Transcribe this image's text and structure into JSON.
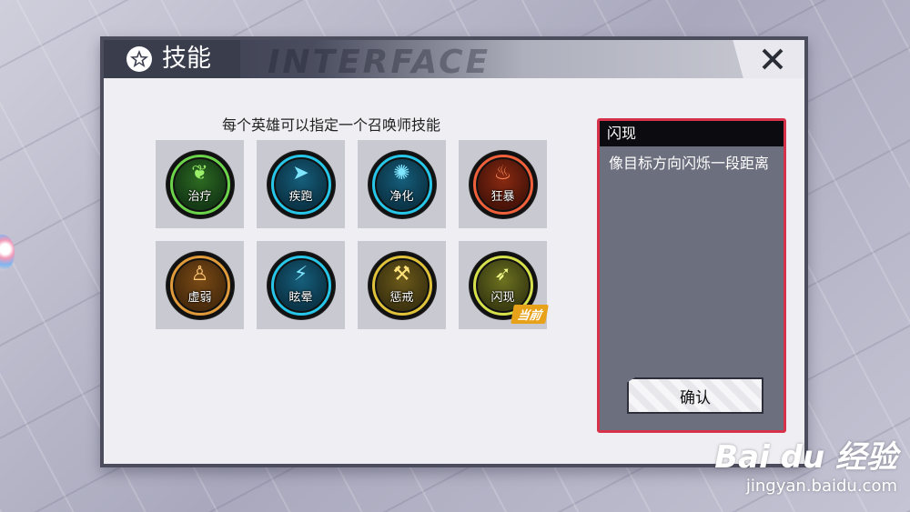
{
  "window": {
    "title": "技能",
    "bg_text": "INTERFACE",
    "close_label": "✕"
  },
  "instruction": "每个英雄可以指定一个召唤师技能",
  "skills": [
    {
      "label": "治疗",
      "icon": "leaf-icon",
      "glyph": "❦",
      "ring": "#6bd44a",
      "c1": "#143a16",
      "c2": "#2e6b22",
      "glyph_color": "#9bf06a"
    },
    {
      "label": "疾跑",
      "icon": "runner-icon",
      "glyph": "➤",
      "ring": "#27c6e8",
      "c1": "#0b3548",
      "c2": "#165f7c",
      "glyph_color": "#7fe6ff"
    },
    {
      "label": "净化",
      "icon": "swirl-icon",
      "glyph": "✺",
      "ring": "#27c6e8",
      "c1": "#0b3548",
      "c2": "#165f7c",
      "glyph_color": "#7fe6ff"
    },
    {
      "label": "狂暴",
      "icon": "berserk-icon",
      "glyph": "♨",
      "ring": "#f0603a",
      "c1": "#4a1409",
      "c2": "#8a2a12",
      "glyph_color": "#ff8a5a"
    },
    {
      "label": "虚弱",
      "icon": "weak-figure-icon",
      "glyph": "♙",
      "ring": "#e09a3a",
      "c1": "#4a2c0c",
      "c2": "#7a4a16",
      "glyph_color": "#ffc978"
    },
    {
      "label": "眩晕",
      "icon": "lightning-icon",
      "glyph": "⚡",
      "ring": "#27c6e8",
      "c1": "#0b3548",
      "c2": "#165f7c",
      "glyph_color": "#7fe6ff"
    },
    {
      "label": "惩戒",
      "icon": "hammer-icon",
      "glyph": "⚒",
      "ring": "#e0c23a",
      "c1": "#3e3410",
      "c2": "#6c5a1a",
      "glyph_color": "#ffe27a"
    },
    {
      "label": "闪现",
      "icon": "dash-figure-icon",
      "glyph": "➶",
      "ring": "#d6e04a",
      "c1": "#3c3e12",
      "c2": "#6d7220",
      "glyph_color": "#f4ff8a",
      "badge": "当前"
    }
  ],
  "detail": {
    "name": "闪现",
    "description": "像目标方向闪烁一段距离",
    "confirm_label": "确认"
  },
  "watermark": {
    "brand": "Bai du 经验",
    "url": "jingyan.baidu.com"
  },
  "colors": {
    "accent": "#d7324b",
    "panel_dark": "#3a3d4c",
    "badge": "#e8a21a"
  }
}
